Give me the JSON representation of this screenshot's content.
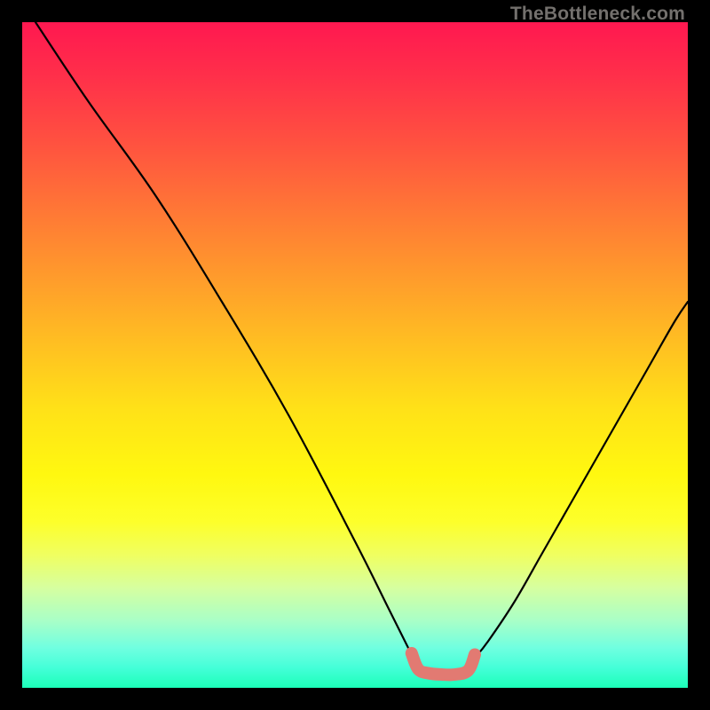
{
  "watermark": "TheBottleneck.com",
  "chart_data": {
    "type": "line",
    "title": "",
    "xlabel": "",
    "ylabel": "",
    "xlim": [
      0,
      100
    ],
    "ylim": [
      0,
      100
    ],
    "grid": false,
    "background_gradient": {
      "direction": "vertical",
      "stops": [
        {
          "pos": 0.0,
          "color": "#ff1850"
        },
        {
          "pos": 0.5,
          "color": "#ffd11c"
        },
        {
          "pos": 0.75,
          "color": "#fdff2a"
        },
        {
          "pos": 1.0,
          "color": "#1cffb8"
        }
      ]
    },
    "series": [
      {
        "name": "left-curve",
        "color": "#000000",
        "width": 2.2,
        "x": [
          2,
          10,
          20,
          30,
          40,
          50,
          55,
          58,
          59.5
        ],
        "values": [
          100,
          88,
          74,
          58,
          41,
          22,
          12,
          6,
          3
        ]
      },
      {
        "name": "right-curve",
        "color": "#000000",
        "width": 2.2,
        "x": [
          68,
          70,
          74,
          78,
          82,
          86,
          90,
          94,
          98,
          100
        ],
        "values": [
          4.5,
          7,
          13,
          20,
          27,
          34,
          41,
          48,
          55,
          58
        ]
      },
      {
        "name": "trough-highlight",
        "color": "#e27a72",
        "width": 14,
        "x": [
          58.5,
          59.5,
          61,
          63,
          65,
          67,
          68
        ],
        "values": [
          5.2,
          2.8,
          2.2,
          2.0,
          2.0,
          2.6,
          5.0
        ]
      }
    ],
    "annotations": []
  }
}
